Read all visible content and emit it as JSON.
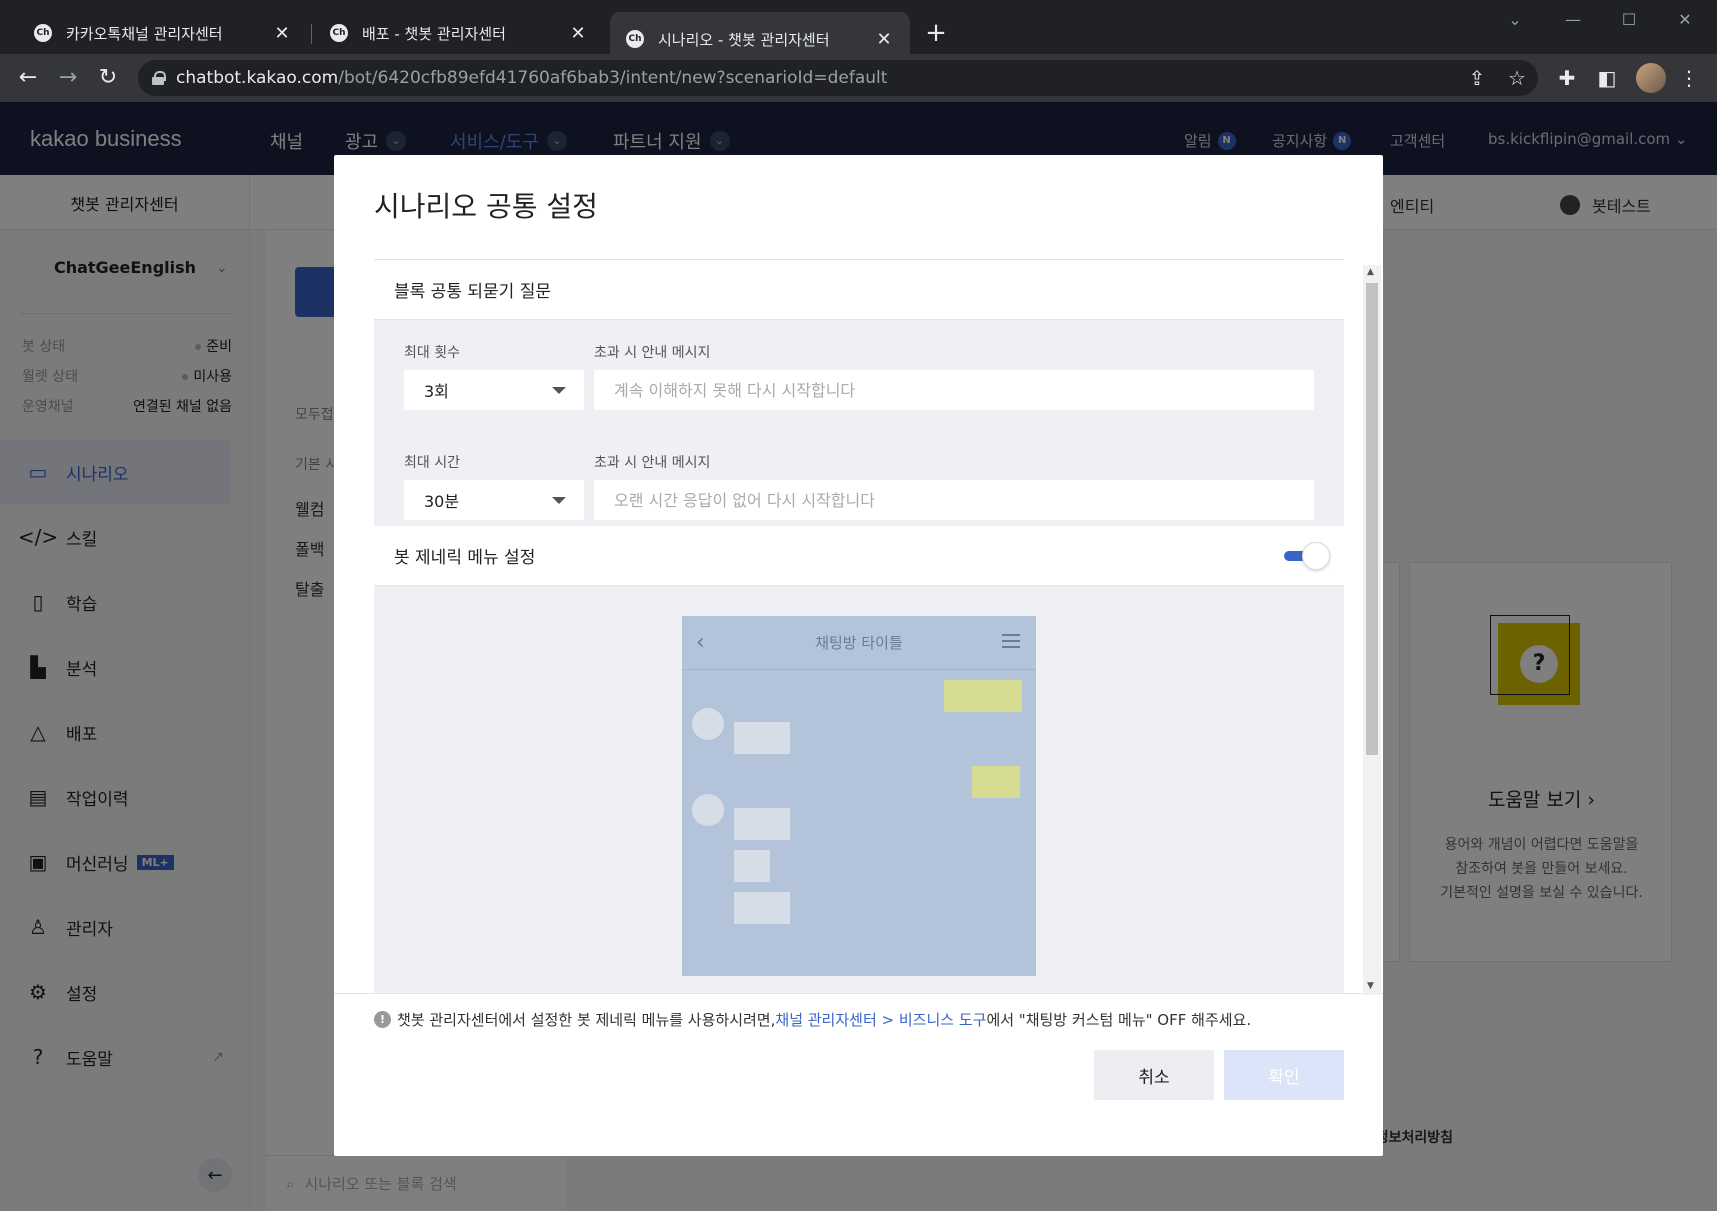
{
  "browser": {
    "tabs": [
      {
        "favicon": "Ch",
        "label": "카카오톡채널 관리자센터",
        "close": "✕"
      },
      {
        "favicon": "Ch",
        "label": "배포 - 챗봇 관리자센터",
        "close": "✕"
      },
      {
        "favicon": "Ch",
        "label": "시나리오 - 챗봇 관리자센터",
        "close": "✕"
      }
    ],
    "active_tab_index": 2,
    "new_tab": "+",
    "url_host": "chatbot.kakao.com",
    "url_path": "/bot/6420cfb89efd41760af6bab3/intent/new?scenarioId=default"
  },
  "header": {
    "brand": "kakao business",
    "menus": [
      {
        "label": "채널",
        "has_dropdown": false
      },
      {
        "label": "광고",
        "has_dropdown": true
      },
      {
        "label": "서비스/도구",
        "has_dropdown": true,
        "active": true
      },
      {
        "label": "파트너 지원",
        "has_dropdown": true
      }
    ],
    "right": {
      "alarm": "알림",
      "notice": "공지사항",
      "badge": "N",
      "support": "고객센터",
      "account": "bs.kickflipin@gmail.com ⌄"
    }
  },
  "subbar": {
    "title": "챗봇 관리자센터",
    "entity": "엔티티",
    "bottest": "봇테스트"
  },
  "sidebar": {
    "bot_name": "ChatGeeEnglish",
    "status": [
      {
        "key": "봇 상태",
        "value": "준비"
      },
      {
        "key": "월렛 상태",
        "value": "미사용"
      },
      {
        "key": "운영채널",
        "value": "연결된 채널 없음"
      }
    ],
    "items": [
      {
        "label": "시나리오",
        "icon": "scenario-icon",
        "active": true
      },
      {
        "label": "스킬",
        "icon": "code-icon"
      },
      {
        "label": "학습",
        "icon": "book-icon"
      },
      {
        "label": "분석",
        "icon": "chart-icon"
      },
      {
        "label": "배포",
        "icon": "deploy-icon"
      },
      {
        "label": "작업이력",
        "icon": "history-icon"
      },
      {
        "label": "머신러닝",
        "icon": "chip-icon",
        "badge": "ML+"
      },
      {
        "label": "관리자",
        "icon": "admin-icon"
      },
      {
        "label": "설정",
        "icon": "gear-icon"
      },
      {
        "label": "도움말",
        "icon": "help-icon",
        "external": true
      }
    ]
  },
  "content": {
    "left_labels": [
      "모두접",
      "기본 시",
      "웰컴",
      "폴백",
      "탈출"
    ],
    "search_placeholder": "시나리오 또는 블록 검색",
    "help": {
      "title": "도움말 보기 ›",
      "desc": "용어와 개념이 어렵다면 도움말을\n참조하여 봇을 만들어 보세요.\n기본적인 설명을 보실 수 있습니다."
    },
    "footer_link": "개인정보처리방침"
  },
  "modal": {
    "title": "시나리오 공통 설정",
    "reprompt_section": "블록 공통 되묻기 질문",
    "max_count_label": "최대 횟수",
    "max_count_value": "3회",
    "count_msg_label": "초과 시 안내 메시지",
    "count_msg_placeholder": "계속 이해하지 못해 다시 시작합니다",
    "max_time_label": "최대 시간",
    "max_time_value": "30분",
    "time_msg_label": "초과 시 안내 메시지",
    "time_msg_placeholder": "오랜 시간 응답이 없어 다시 시작합니다",
    "generic_menu_section": "봇 제네릭 메뉴 설정",
    "generic_menu_enabled": true,
    "phone_title": "채팅방 타이틀",
    "notice_pre": "챗봇 관리자센터에서 설정한 봇 제네릭 메뉴를 사용하시려면, ",
    "notice_link": "채널 관리자센터 > 비즈니스 도구",
    "notice_post": "에서 \"채팅방 커스텀 메뉴\" OFF 해주세요.",
    "cancel": "취소",
    "confirm": "확인"
  },
  "colors": {
    "nav_bg": "#1c2541",
    "accent": "#3a64c8",
    "confirm_disabled": "#dbe4f8",
    "phone_bg": "#b3c3d9",
    "bubble_yellow": "#d5dc91"
  }
}
